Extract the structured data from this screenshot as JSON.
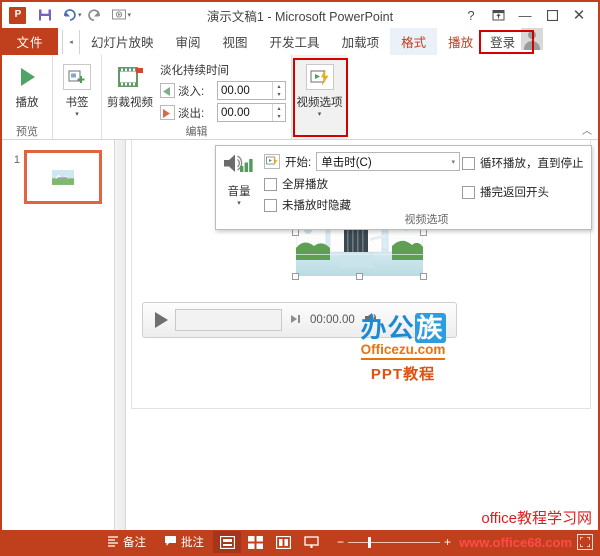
{
  "window": {
    "title": "演示文稿1 - Microsoft PowerPoint",
    "logo_text": "P",
    "help_label": "?",
    "ribbon_display_label": "▣",
    "minimize_label": "—",
    "maximize_label": "❐",
    "close_label": "✕"
  },
  "quick_access": {
    "save_label": "save-icon",
    "undo_label": "↶",
    "undo_caret": "▾",
    "redo_label": "↻",
    "present_label": "▣",
    "more_label": "▾"
  },
  "tabs": {
    "file_label": "文件",
    "scroll_left_label": "◂",
    "items": [
      {
        "label": "幻灯片放映",
        "state": "normal"
      },
      {
        "label": "审阅",
        "state": "normal"
      },
      {
        "label": "视图",
        "state": "normal"
      },
      {
        "label": "开发工具",
        "state": "normal"
      },
      {
        "label": "加载项",
        "state": "normal"
      },
      {
        "label": "格式",
        "state": "contextual-selected"
      },
      {
        "label": "播放",
        "state": "contextual-active"
      }
    ],
    "signin_label": "登录"
  },
  "ribbon": {
    "groups": [
      {
        "title": "预览",
        "buttons": [
          {
            "label": "播放",
            "icon": "play-triangle-icon",
            "caret": ""
          }
        ]
      },
      {
        "title": "",
        "buttons": [
          {
            "label": "书签",
            "icon": "bookmark-add-icon",
            "caret": "▾"
          }
        ]
      },
      {
        "title": "编辑",
        "buttons": [
          {
            "label": "剪裁视频",
            "icon": "film-strip-icon",
            "caret": ""
          }
        ],
        "fade": {
          "heading": "淡化持续时间",
          "fade_in_label": "淡入:",
          "fade_in_value": "00.00",
          "fade_out_label": "淡出:",
          "fade_out_value": "00.00",
          "spin_up": "▴",
          "spin_down": "▾"
        }
      },
      {
        "title": "",
        "buttons": [
          {
            "label": "视频选项",
            "icon": "video-options-icon",
            "caret": "▾"
          }
        ]
      }
    ],
    "collapse_label": "︿"
  },
  "video_options_panel": {
    "group_title": "视频选项",
    "volume_label": "音量",
    "volume_caret": "▾",
    "start_label": "开始:",
    "start_value": "单击时(C)",
    "start_caret": "▾",
    "checkboxes": [
      {
        "label": "全屏播放",
        "checked": false
      },
      {
        "label": "未播放时隐藏",
        "checked": false
      },
      {
        "label": "循环播放，直到停止",
        "checked": false
      },
      {
        "label": "播完返回开头",
        "checked": false
      }
    ]
  },
  "slide_pane": {
    "slides": [
      {
        "number": "1",
        "selected": true
      }
    ]
  },
  "canvas": {
    "media_bar": {
      "play_label": "play-icon",
      "step_label": "step-forward-icon",
      "time": "00:00.00",
      "volume_label": "speaker-icon"
    },
    "watermark": {
      "line1_a": "办公",
      "line1_b": "族",
      "line2": "Officezu.com",
      "line3": "PPT教程"
    },
    "bottom_watermark": "office教程学习网"
  },
  "status_bar": {
    "notes_label": "备注",
    "comments_label": "批注",
    "views": [
      {
        "name": "normal-view",
        "glyph": "▤",
        "active": true
      },
      {
        "name": "slide-sorter-view",
        "glyph": "▦",
        "active": false
      },
      {
        "name": "reading-view",
        "glyph": "▥",
        "active": false
      },
      {
        "name": "slideshow-view",
        "glyph": "▭",
        "active": false
      }
    ],
    "zoom_out_label": "−",
    "zoom_in_label": "+",
    "fit_label": "⛶",
    "watermark": "www.office68.com"
  },
  "colors": {
    "accent": "#c0401d",
    "highlight_box": "#d40000",
    "thumb_selected": "#e0643f",
    "watermark_blue": "#1b8ad6",
    "watermark_orange": "#e8730c",
    "watermark_red": "#e11b1b"
  }
}
